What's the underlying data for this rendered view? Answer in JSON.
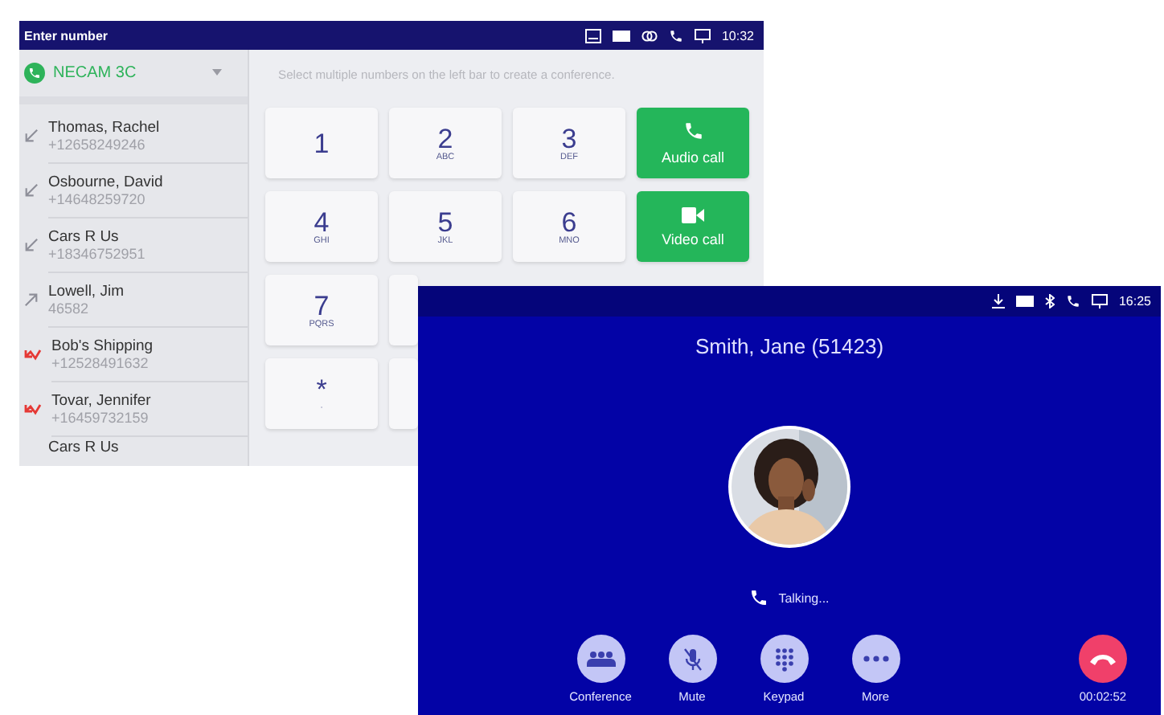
{
  "dialer": {
    "title": "Enter number",
    "status_time": "10:32",
    "account": {
      "name": "NECAM 3C"
    },
    "hint": "Select multiple numbers on the left bar to create a conference.",
    "history": [
      {
        "name": "Thomas, Rachel",
        "number": "+12658249246",
        "kind": "incoming"
      },
      {
        "name": "Osbourne, David",
        "number": "+14648259720",
        "kind": "incoming"
      },
      {
        "name": "Cars R Us",
        "number": "+18346752951",
        "kind": "incoming"
      },
      {
        "name": "Lowell, Jim",
        "number": "46582",
        "kind": "outgoing"
      },
      {
        "name": "Bob's Shipping",
        "number": "+12528491632",
        "kind": "missed"
      },
      {
        "name": "Tovar, Jennifer",
        "number": "+16459732159",
        "kind": "missed"
      },
      {
        "name": "Cars R Us",
        "kind": "none"
      }
    ],
    "keypad": [
      [
        {
          "kind": "digit",
          "digit": "1"
        },
        {
          "kind": "digit",
          "digit": "2",
          "letters": "ABC"
        },
        {
          "kind": "digit",
          "digit": "3",
          "letters": "DEF"
        },
        {
          "kind": "audio-call",
          "label": "Audio call"
        }
      ],
      [
        {
          "kind": "digit",
          "digit": "4",
          "letters": "GHI"
        },
        {
          "kind": "digit",
          "digit": "5",
          "letters": "JKL"
        },
        {
          "kind": "digit",
          "digit": "6",
          "letters": "MNO"
        },
        {
          "kind": "video-call",
          "label": "Video call"
        }
      ],
      [
        {
          "kind": "digit",
          "digit": "7",
          "letters": "PQRS"
        },
        {
          "kind": "covered"
        }
      ],
      [
        {
          "kind": "digit",
          "digit": "*",
          "letters": "·"
        },
        {
          "kind": "covered"
        }
      ]
    ]
  },
  "call": {
    "status_time": "16:25",
    "caller": "Smith, Jane (51423)",
    "state": "Talking...",
    "actions": [
      {
        "label": "Conference"
      },
      {
        "label": "Mute"
      },
      {
        "label": "Keypad"
      },
      {
        "label": "More"
      }
    ],
    "hangup": {
      "duration": "00:02:52"
    }
  }
}
